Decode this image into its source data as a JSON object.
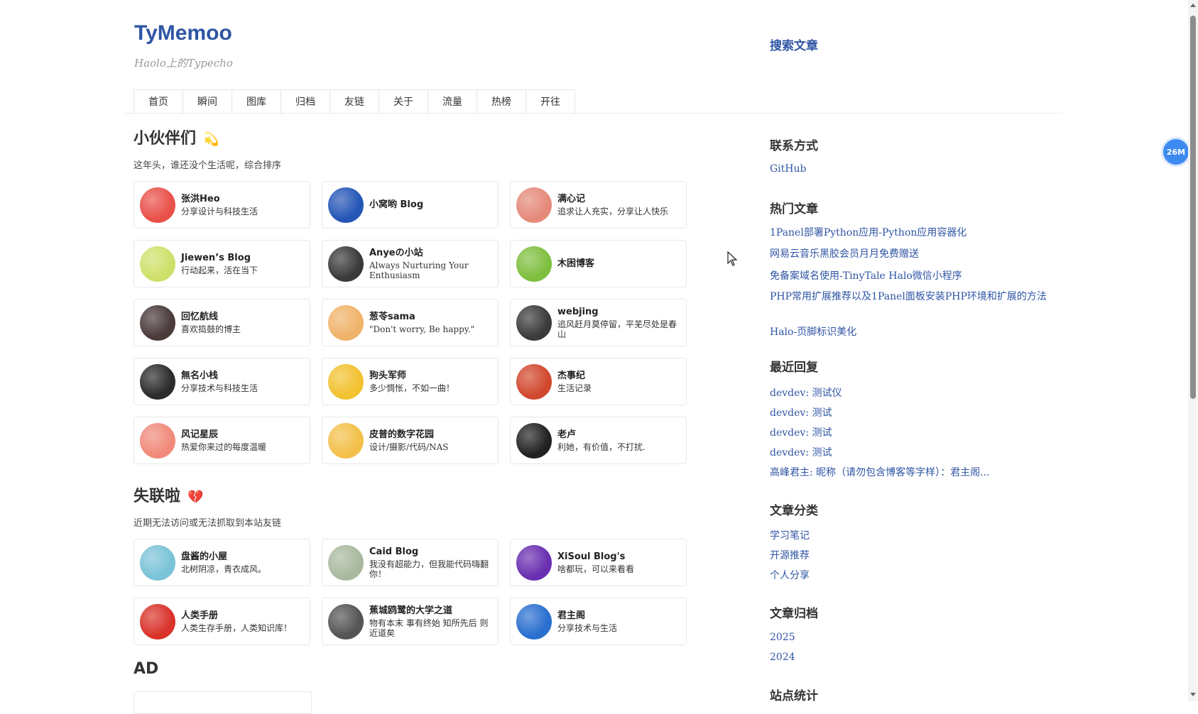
{
  "site": {
    "title": "TyMemoo",
    "subtitle": "Haolo上的Typecho",
    "search_label": "搜索文章"
  },
  "nav": [
    "首页",
    "瞬间",
    "图库",
    "归档",
    "友链",
    "关于",
    "流量",
    "热榜",
    "开往"
  ],
  "friends": {
    "heading": "小伙伴们",
    "emoji": "💫",
    "subtitle": "这年头，谁还没个生活呢，综合排序",
    "items": [
      {
        "name": "张洪Heo",
        "desc": "分享设计与科技生活",
        "avatar_icon": "red-bear-avatar",
        "color": "#e9504a"
      },
      {
        "name": "小窝哟 Blog",
        "desc": "",
        "avatar_icon": "blue-ring-avatar",
        "color": "#2456b6"
      },
      {
        "name": "满心记",
        "desc": "追求让人充实，分享让人快乐",
        "avatar_icon": "cartoon-pig-avatar",
        "color": "#e58a7a"
      },
      {
        "name": "Jiewen’s Blog",
        "desc": "行动起来，活在当下",
        "avatar_icon": "letter-w-avatar",
        "color": "#cfe06a"
      },
      {
        "name": "Anyeの小站",
        "desc": "Always Nurturing Your Enthusiasm",
        "avatar_icon": "glasses-boy-avatar",
        "color": "#3a3a3a"
      },
      {
        "name": "木困博客",
        "desc": "",
        "avatar_icon": "calligraphy-avatar",
        "color": "#7fbf3f"
      },
      {
        "name": "回忆航线",
        "desc": "喜欢捣鼓的博主",
        "avatar_icon": "anime-girl-avatar",
        "color": "#4a3a3a"
      },
      {
        "name": "葱苓sama",
        "desc": "\"Don't worry, Be happy.\"",
        "avatar_icon": "anime-blonde-avatar",
        "color": "#f0b36a"
      },
      {
        "name": "webjing",
        "desc": "追风赶月莫停留，平芜尽处是春山",
        "avatar_icon": "dark-boy-avatar",
        "color": "#3b3b3b"
      },
      {
        "name": "無名小栈",
        "desc": "分享技术与科技生活",
        "avatar_icon": "clock-avatar",
        "color": "#2b2b2b"
      },
      {
        "name": "狗头军师",
        "desc": "多少惆怅，不如一曲！",
        "avatar_icon": "yellow-dog-avatar",
        "color": "#f2c230"
      },
      {
        "name": "杰事纪",
        "desc": "生活记录",
        "avatar_icon": "stamp-logo-avatar",
        "color": "#d2482f"
      },
      {
        "name": "风记星辰",
        "desc": "热爱你来过的每度温暖",
        "avatar_icon": "two-circles-avatar",
        "color": "#f08a7a"
      },
      {
        "name": "皮普的数字花园",
        "desc": "设计/摄影/代码/NAS",
        "avatar_icon": "smiling-boy-avatar",
        "color": "#f3c04a"
      },
      {
        "name": "老卢",
        "desc": "利她，有价值，不打扰.",
        "avatar_icon": "ink-figure-avatar",
        "color": "#222222"
      }
    ]
  },
  "lost": {
    "heading": "失联啦",
    "emoji": "💔",
    "subtitle": "近期无法访问或无法抓取到本站友链",
    "items": [
      {
        "name": "盘酱的小屋",
        "desc": "北树阴凉，青衣成风。",
        "avatar_icon": "anime-teal-avatar",
        "color": "#7ac3d8"
      },
      {
        "name": "Caid Blog",
        "desc": "我没有超能力，但我能代码嗨翻你！",
        "avatar_icon": "landscape-avatar",
        "color": "#a9b9a0"
      },
      {
        "name": "XiSoul Blog's",
        "desc": "啥都玩，可以来看看",
        "avatar_icon": "swirl-avatar",
        "color": "#6a2fb0"
      },
      {
        "name": "人类手册",
        "desc": "人类生存手册，人类知识库！",
        "avatar_icon": "letter-g-avatar",
        "color": "#d9332a"
      },
      {
        "name": "蕉城鸥鹭的大学之道",
        "desc": "物有本末 事有终始 知所先后 则近道矣",
        "avatar_icon": "seal-avatar",
        "color": "#555555"
      },
      {
        "name": "君主阁",
        "desc": "分享技术与生活",
        "avatar_icon": "blue-3-avatar",
        "color": "#2a6fcf"
      }
    ]
  },
  "ad": {
    "heading": "AD"
  },
  "sidebar": {
    "contact": {
      "heading": "联系方式",
      "links": [
        "GitHub"
      ]
    },
    "hot": {
      "heading": "热门文章",
      "links": [
        "1Panel部署Python应用-Python应用容器化",
        "网易云音乐黑胶会员月月免费赠送",
        "免备案域名使用-TinyTale Halo微信小程序",
        "PHP常用扩展推荐以及1Panel面板安装PHP环境和扩展的方法",
        "Halo-页脚标识美化"
      ]
    },
    "replies": {
      "heading": "最近回复",
      "links": [
        "devdev: 测试仪",
        "devdev: 测试",
        "devdev: 测试",
        "devdev: 测试",
        "高峰君主: 昵称（请勿包含博客等字样）：君主阁..."
      ]
    },
    "categories": {
      "heading": "文章分类",
      "links": [
        "学习笔记",
        "开源推荐",
        "个人分享"
      ]
    },
    "archives": {
      "heading": "文章归档",
      "links": [
        "2025",
        "2024"
      ]
    },
    "stats": {
      "heading": "站点统计"
    }
  },
  "memory_badge": "26M",
  "colors": {
    "accent": "#2f55a4",
    "badge": "#3d8bf0"
  }
}
